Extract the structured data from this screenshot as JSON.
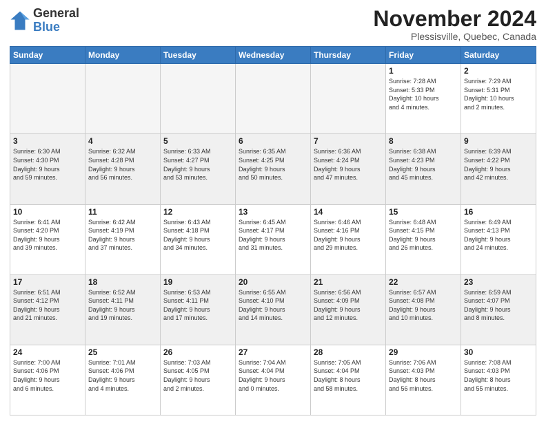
{
  "logo": {
    "general": "General",
    "blue": "Blue"
  },
  "header": {
    "month": "November 2024",
    "location": "Plessisville, Quebec, Canada"
  },
  "days_of_week": [
    "Sunday",
    "Monday",
    "Tuesday",
    "Wednesday",
    "Thursday",
    "Friday",
    "Saturday"
  ],
  "weeks": [
    {
      "shade": false,
      "days": [
        {
          "num": "",
          "info": ""
        },
        {
          "num": "",
          "info": ""
        },
        {
          "num": "",
          "info": ""
        },
        {
          "num": "",
          "info": ""
        },
        {
          "num": "",
          "info": ""
        },
        {
          "num": "1",
          "info": "Sunrise: 7:28 AM\nSunset: 5:33 PM\nDaylight: 10 hours\nand 4 minutes."
        },
        {
          "num": "2",
          "info": "Sunrise: 7:29 AM\nSunset: 5:31 PM\nDaylight: 10 hours\nand 2 minutes."
        }
      ]
    },
    {
      "shade": true,
      "days": [
        {
          "num": "3",
          "info": "Sunrise: 6:30 AM\nSunset: 4:30 PM\nDaylight: 9 hours\nand 59 minutes."
        },
        {
          "num": "4",
          "info": "Sunrise: 6:32 AM\nSunset: 4:28 PM\nDaylight: 9 hours\nand 56 minutes."
        },
        {
          "num": "5",
          "info": "Sunrise: 6:33 AM\nSunset: 4:27 PM\nDaylight: 9 hours\nand 53 minutes."
        },
        {
          "num": "6",
          "info": "Sunrise: 6:35 AM\nSunset: 4:25 PM\nDaylight: 9 hours\nand 50 minutes."
        },
        {
          "num": "7",
          "info": "Sunrise: 6:36 AM\nSunset: 4:24 PM\nDaylight: 9 hours\nand 47 minutes."
        },
        {
          "num": "8",
          "info": "Sunrise: 6:38 AM\nSunset: 4:23 PM\nDaylight: 9 hours\nand 45 minutes."
        },
        {
          "num": "9",
          "info": "Sunrise: 6:39 AM\nSunset: 4:22 PM\nDaylight: 9 hours\nand 42 minutes."
        }
      ]
    },
    {
      "shade": false,
      "days": [
        {
          "num": "10",
          "info": "Sunrise: 6:41 AM\nSunset: 4:20 PM\nDaylight: 9 hours\nand 39 minutes."
        },
        {
          "num": "11",
          "info": "Sunrise: 6:42 AM\nSunset: 4:19 PM\nDaylight: 9 hours\nand 37 minutes."
        },
        {
          "num": "12",
          "info": "Sunrise: 6:43 AM\nSunset: 4:18 PM\nDaylight: 9 hours\nand 34 minutes."
        },
        {
          "num": "13",
          "info": "Sunrise: 6:45 AM\nSunset: 4:17 PM\nDaylight: 9 hours\nand 31 minutes."
        },
        {
          "num": "14",
          "info": "Sunrise: 6:46 AM\nSunset: 4:16 PM\nDaylight: 9 hours\nand 29 minutes."
        },
        {
          "num": "15",
          "info": "Sunrise: 6:48 AM\nSunset: 4:15 PM\nDaylight: 9 hours\nand 26 minutes."
        },
        {
          "num": "16",
          "info": "Sunrise: 6:49 AM\nSunset: 4:13 PM\nDaylight: 9 hours\nand 24 minutes."
        }
      ]
    },
    {
      "shade": true,
      "days": [
        {
          "num": "17",
          "info": "Sunrise: 6:51 AM\nSunset: 4:12 PM\nDaylight: 9 hours\nand 21 minutes."
        },
        {
          "num": "18",
          "info": "Sunrise: 6:52 AM\nSunset: 4:11 PM\nDaylight: 9 hours\nand 19 minutes."
        },
        {
          "num": "19",
          "info": "Sunrise: 6:53 AM\nSunset: 4:11 PM\nDaylight: 9 hours\nand 17 minutes."
        },
        {
          "num": "20",
          "info": "Sunrise: 6:55 AM\nSunset: 4:10 PM\nDaylight: 9 hours\nand 14 minutes."
        },
        {
          "num": "21",
          "info": "Sunrise: 6:56 AM\nSunset: 4:09 PM\nDaylight: 9 hours\nand 12 minutes."
        },
        {
          "num": "22",
          "info": "Sunrise: 6:57 AM\nSunset: 4:08 PM\nDaylight: 9 hours\nand 10 minutes."
        },
        {
          "num": "23",
          "info": "Sunrise: 6:59 AM\nSunset: 4:07 PM\nDaylight: 9 hours\nand 8 minutes."
        }
      ]
    },
    {
      "shade": false,
      "days": [
        {
          "num": "24",
          "info": "Sunrise: 7:00 AM\nSunset: 4:06 PM\nDaylight: 9 hours\nand 6 minutes."
        },
        {
          "num": "25",
          "info": "Sunrise: 7:01 AM\nSunset: 4:06 PM\nDaylight: 9 hours\nand 4 minutes."
        },
        {
          "num": "26",
          "info": "Sunrise: 7:03 AM\nSunset: 4:05 PM\nDaylight: 9 hours\nand 2 minutes."
        },
        {
          "num": "27",
          "info": "Sunrise: 7:04 AM\nSunset: 4:04 PM\nDaylight: 9 hours\nand 0 minutes."
        },
        {
          "num": "28",
          "info": "Sunrise: 7:05 AM\nSunset: 4:04 PM\nDaylight: 8 hours\nand 58 minutes."
        },
        {
          "num": "29",
          "info": "Sunrise: 7:06 AM\nSunset: 4:03 PM\nDaylight: 8 hours\nand 56 minutes."
        },
        {
          "num": "30",
          "info": "Sunrise: 7:08 AM\nSunset: 4:03 PM\nDaylight: 8 hours\nand 55 minutes."
        }
      ]
    }
  ]
}
